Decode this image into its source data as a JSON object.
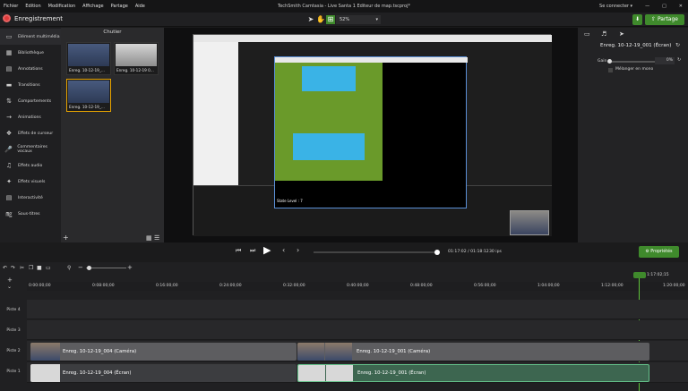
{
  "menubar": {
    "items": [
      "Fichier",
      "Edition",
      "Modification",
      "Affichage",
      "Partage",
      "Aide"
    ],
    "title": "TechSmith Camtasia - Live Santa 1 Editeur de map.tscproj*",
    "connect": "Se connecter ▾"
  },
  "toolbar": {
    "record_label": "Enregistrement",
    "zoom": "52%",
    "share_label": "Partage"
  },
  "nav": {
    "items": [
      {
        "label": "Elément multimédia",
        "icon": "media-icon"
      },
      {
        "label": "Bibliothèque",
        "icon": "library-icon"
      },
      {
        "label": "Annotations",
        "icon": "annotations-icon"
      },
      {
        "label": "Transitions",
        "icon": "transitions-icon"
      },
      {
        "label": "Comportements",
        "icon": "behaviors-icon"
      },
      {
        "label": "Animations",
        "icon": "animations-icon"
      },
      {
        "label": "Effets de curseur",
        "icon": "cursor-effects-icon"
      },
      {
        "label": "Commentaires vocaux",
        "icon": "voice-icon"
      },
      {
        "label": "Effets audio",
        "icon": "audio-effects-icon"
      },
      {
        "label": "Effets visuels",
        "icon": "visual-effects-icon"
      },
      {
        "label": "Interactivité",
        "icon": "interactivity-icon"
      },
      {
        "label": "Sous-titres",
        "icon": "captions-icon"
      }
    ]
  },
  "bin": {
    "header": "Chutier",
    "clips": [
      "Enreg. 10-12-19_...",
      "Enreg. 10-12-19 0...",
      "Enreg. 10-12-19_..."
    ]
  },
  "canvas": {
    "game_status": "State Level : 7"
  },
  "props": {
    "clip_title": "Enreg. 10-12-19_001 (Écran)",
    "gain_label": "Gain",
    "gain_value": "0%",
    "mix_label": "Mélanger en mono"
  },
  "playback": {
    "time": "01:17:02 / 01:18:12",
    "fps": "30 ips",
    "properties_label": "Propriétés"
  },
  "timeline": {
    "playhead_time": "1:17:02;15",
    "ticks": [
      "0:00:00;00",
      "0:08:00;00",
      "0:16:00;00",
      "0:24:00;00",
      "0:32:00;00",
      "0:40:00;00",
      "0:48:00;00",
      "0:56:00;00",
      "1:04:00;00",
      "1:12:00;00",
      "1:20:00;00"
    ],
    "tracks": [
      "Piste 4",
      "Piste 3",
      "Piste 2",
      "Piste 1"
    ],
    "clips": {
      "cam1": "Enreg. 10-12-19_004 (Caméra)",
      "cam2": "Enreg. 10-12-19_001 (Caméra)",
      "scr1": "Enreg. 10-12-19_004 (Écran)",
      "scr2": "Enreg. 10-12-19_001 (Écran)"
    }
  }
}
